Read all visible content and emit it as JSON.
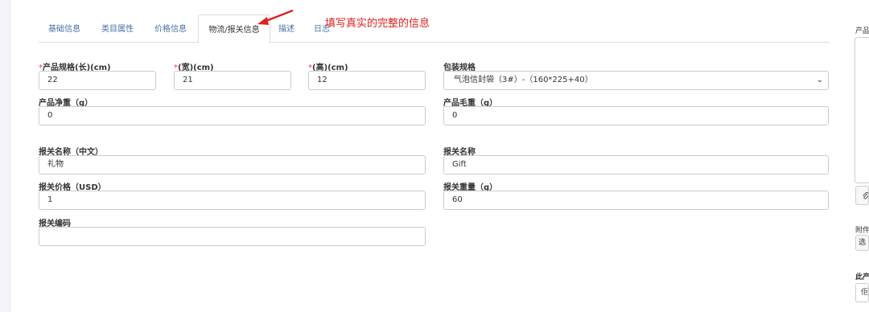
{
  "tabs": [
    {
      "label": "基础信息"
    },
    {
      "label": "类目属性"
    },
    {
      "label": "价格信息"
    },
    {
      "label": "物流/报关信息"
    },
    {
      "label": "描述"
    },
    {
      "label": "日志"
    }
  ],
  "annotation": {
    "text": "填写真实的完整的信息",
    "color": "#e02020"
  },
  "form": {
    "length": {
      "required_mark": "*",
      "label": "产品规格(长)(cm)",
      "value": "22"
    },
    "width": {
      "required_mark": "*",
      "label": "(宽)(cm)",
      "value": "21"
    },
    "height": {
      "required_mark": "*",
      "label": "(高)(cm)",
      "value": "12"
    },
    "packaging": {
      "label": "包装规格",
      "value": "气泡信封袋（3#）-（160*225+40）"
    },
    "net_weight": {
      "label": "产品净重（g）",
      "value": "0"
    },
    "gross_weight": {
      "label": "产品毛重（g）",
      "value": "0"
    },
    "customs_name_cn": {
      "label": "报关名称（中文）",
      "value": "礼物"
    },
    "customs_name": {
      "label": "报关名称",
      "value": "Gift"
    },
    "customs_price": {
      "label": "报关价格（USD）",
      "value": "1"
    },
    "customs_weight": {
      "label": "报关重量（g）",
      "value": "60"
    },
    "customs_code": {
      "label": "报关编码",
      "value": ""
    }
  },
  "right_panel": {
    "label_top": "产品",
    "attach_label": "附件",
    "select_button": "选",
    "bottom_label": "此产",
    "bottom_value": "佢",
    "paperclip_icon": "paperclip-icon"
  },
  "colors": {
    "link": "#4a6fa5",
    "required": "#e53935",
    "annotation": "#e02020"
  }
}
